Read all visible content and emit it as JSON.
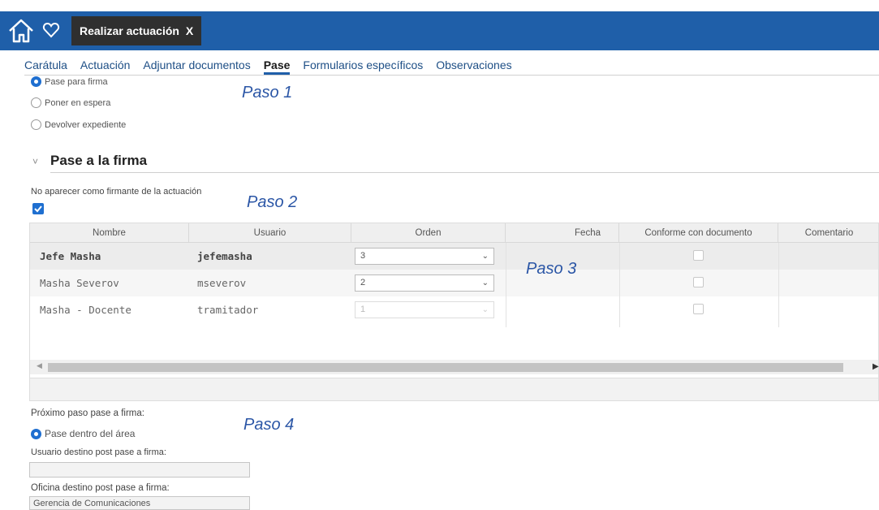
{
  "header": {
    "active_tab_label": "Realizar actuación",
    "active_tab_close": "X"
  },
  "subtabs": [
    {
      "label": "Carátula"
    },
    {
      "label": "Actuación"
    },
    {
      "label": "Adjuntar documentos"
    },
    {
      "label": "Pase",
      "active": true
    },
    {
      "label": "Formularios específicos"
    },
    {
      "label": "Observaciones"
    }
  ],
  "options": {
    "pase_firma": "Pase para firma",
    "poner_espera": "Poner en espera",
    "devolver": "Devolver expediente"
  },
  "annotations": {
    "paso1": "Paso 1",
    "paso2": "Paso 2",
    "paso3": "Paso 3",
    "paso4": "Paso 4"
  },
  "section": {
    "title": "Pase a la firma",
    "no_firmante_label": "No aparecer como firmante de la actuación"
  },
  "table": {
    "headers": [
      "Nombre",
      "Usuario",
      "Orden",
      "Fecha",
      "Conforme con documento",
      "Comentario"
    ],
    "rows": [
      {
        "nombre": "Jefe Masha",
        "usuario": "jefemasha",
        "orden": "3"
      },
      {
        "nombre": "Masha Severov",
        "usuario": "mseverov",
        "orden": "2"
      },
      {
        "nombre": "Masha - Docente",
        "usuario": "tramitador",
        "orden": "1"
      }
    ]
  },
  "next_step": {
    "label": "Próximo paso pase a firma:",
    "option": "Pase dentro del área",
    "usuario_label": "Usuario destino post pase a firma:",
    "usuario_value": "",
    "oficina_label": "Oficina destino post pase a firma:",
    "oficina_value": "Gerencia de Comunicaciones"
  },
  "colors": {
    "header_blue": "#1f5fa9",
    "accent": "#1f6fd0",
    "annotation": "#2b56a6"
  }
}
